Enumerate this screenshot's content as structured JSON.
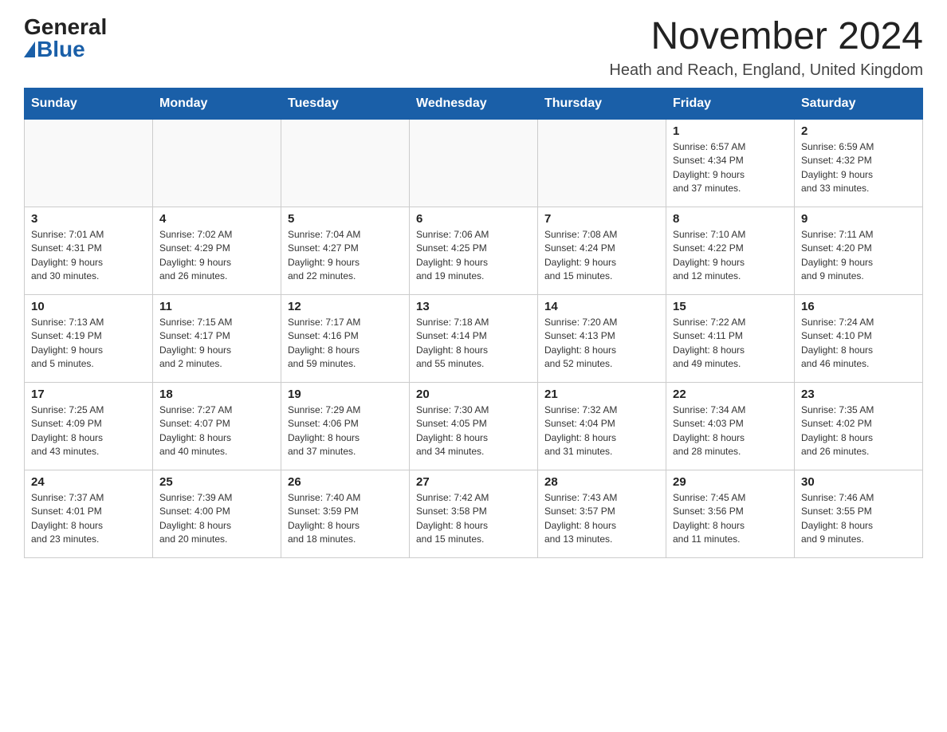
{
  "logo": {
    "general": "General",
    "blue": "Blue"
  },
  "title": "November 2024",
  "location": "Heath and Reach, England, United Kingdom",
  "weekdays": [
    "Sunday",
    "Monday",
    "Tuesday",
    "Wednesday",
    "Thursday",
    "Friday",
    "Saturday"
  ],
  "weeks": [
    [
      {
        "day": "",
        "info": ""
      },
      {
        "day": "",
        "info": ""
      },
      {
        "day": "",
        "info": ""
      },
      {
        "day": "",
        "info": ""
      },
      {
        "day": "",
        "info": ""
      },
      {
        "day": "1",
        "info": "Sunrise: 6:57 AM\nSunset: 4:34 PM\nDaylight: 9 hours\nand 37 minutes."
      },
      {
        "day": "2",
        "info": "Sunrise: 6:59 AM\nSunset: 4:32 PM\nDaylight: 9 hours\nand 33 minutes."
      }
    ],
    [
      {
        "day": "3",
        "info": "Sunrise: 7:01 AM\nSunset: 4:31 PM\nDaylight: 9 hours\nand 30 minutes."
      },
      {
        "day": "4",
        "info": "Sunrise: 7:02 AM\nSunset: 4:29 PM\nDaylight: 9 hours\nand 26 minutes."
      },
      {
        "day": "5",
        "info": "Sunrise: 7:04 AM\nSunset: 4:27 PM\nDaylight: 9 hours\nand 22 minutes."
      },
      {
        "day": "6",
        "info": "Sunrise: 7:06 AM\nSunset: 4:25 PM\nDaylight: 9 hours\nand 19 minutes."
      },
      {
        "day": "7",
        "info": "Sunrise: 7:08 AM\nSunset: 4:24 PM\nDaylight: 9 hours\nand 15 minutes."
      },
      {
        "day": "8",
        "info": "Sunrise: 7:10 AM\nSunset: 4:22 PM\nDaylight: 9 hours\nand 12 minutes."
      },
      {
        "day": "9",
        "info": "Sunrise: 7:11 AM\nSunset: 4:20 PM\nDaylight: 9 hours\nand 9 minutes."
      }
    ],
    [
      {
        "day": "10",
        "info": "Sunrise: 7:13 AM\nSunset: 4:19 PM\nDaylight: 9 hours\nand 5 minutes."
      },
      {
        "day": "11",
        "info": "Sunrise: 7:15 AM\nSunset: 4:17 PM\nDaylight: 9 hours\nand 2 minutes."
      },
      {
        "day": "12",
        "info": "Sunrise: 7:17 AM\nSunset: 4:16 PM\nDaylight: 8 hours\nand 59 minutes."
      },
      {
        "day": "13",
        "info": "Sunrise: 7:18 AM\nSunset: 4:14 PM\nDaylight: 8 hours\nand 55 minutes."
      },
      {
        "day": "14",
        "info": "Sunrise: 7:20 AM\nSunset: 4:13 PM\nDaylight: 8 hours\nand 52 minutes."
      },
      {
        "day": "15",
        "info": "Sunrise: 7:22 AM\nSunset: 4:11 PM\nDaylight: 8 hours\nand 49 minutes."
      },
      {
        "day": "16",
        "info": "Sunrise: 7:24 AM\nSunset: 4:10 PM\nDaylight: 8 hours\nand 46 minutes."
      }
    ],
    [
      {
        "day": "17",
        "info": "Sunrise: 7:25 AM\nSunset: 4:09 PM\nDaylight: 8 hours\nand 43 minutes."
      },
      {
        "day": "18",
        "info": "Sunrise: 7:27 AM\nSunset: 4:07 PM\nDaylight: 8 hours\nand 40 minutes."
      },
      {
        "day": "19",
        "info": "Sunrise: 7:29 AM\nSunset: 4:06 PM\nDaylight: 8 hours\nand 37 minutes."
      },
      {
        "day": "20",
        "info": "Sunrise: 7:30 AM\nSunset: 4:05 PM\nDaylight: 8 hours\nand 34 minutes."
      },
      {
        "day": "21",
        "info": "Sunrise: 7:32 AM\nSunset: 4:04 PM\nDaylight: 8 hours\nand 31 minutes."
      },
      {
        "day": "22",
        "info": "Sunrise: 7:34 AM\nSunset: 4:03 PM\nDaylight: 8 hours\nand 28 minutes."
      },
      {
        "day": "23",
        "info": "Sunrise: 7:35 AM\nSunset: 4:02 PM\nDaylight: 8 hours\nand 26 minutes."
      }
    ],
    [
      {
        "day": "24",
        "info": "Sunrise: 7:37 AM\nSunset: 4:01 PM\nDaylight: 8 hours\nand 23 minutes."
      },
      {
        "day": "25",
        "info": "Sunrise: 7:39 AM\nSunset: 4:00 PM\nDaylight: 8 hours\nand 20 minutes."
      },
      {
        "day": "26",
        "info": "Sunrise: 7:40 AM\nSunset: 3:59 PM\nDaylight: 8 hours\nand 18 minutes."
      },
      {
        "day": "27",
        "info": "Sunrise: 7:42 AM\nSunset: 3:58 PM\nDaylight: 8 hours\nand 15 minutes."
      },
      {
        "day": "28",
        "info": "Sunrise: 7:43 AM\nSunset: 3:57 PM\nDaylight: 8 hours\nand 13 minutes."
      },
      {
        "day": "29",
        "info": "Sunrise: 7:45 AM\nSunset: 3:56 PM\nDaylight: 8 hours\nand 11 minutes."
      },
      {
        "day": "30",
        "info": "Sunrise: 7:46 AM\nSunset: 3:55 PM\nDaylight: 8 hours\nand 9 minutes."
      }
    ]
  ]
}
